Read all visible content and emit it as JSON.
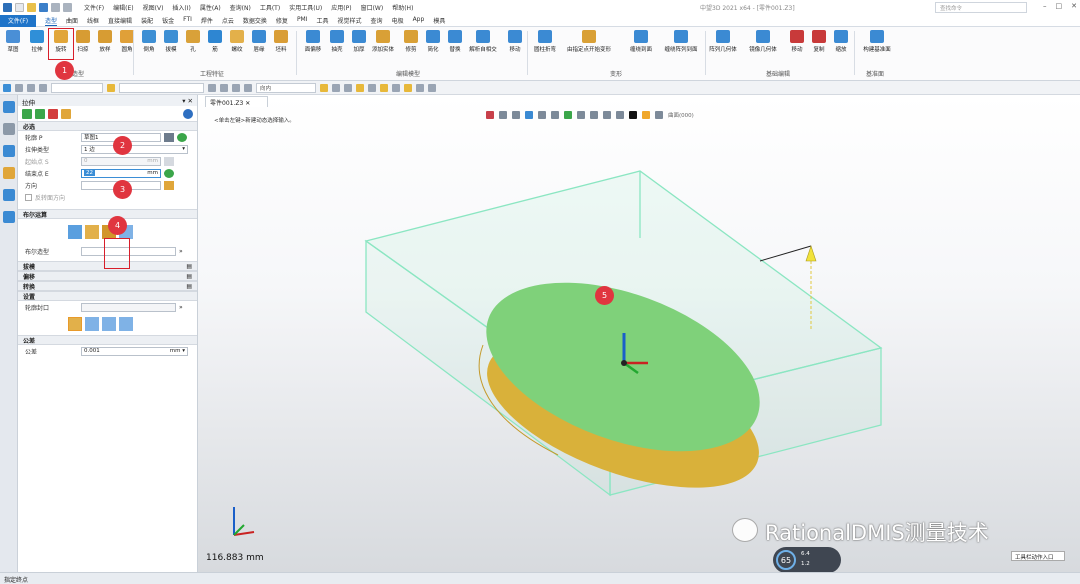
{
  "menu": [
    "文件(F)",
    "编辑(E)",
    "视图(V)",
    "插入(I)",
    "属性(A)",
    "查询(N)",
    "工具(T)",
    "实用工具(U)",
    "应用(P)",
    "窗口(W)",
    "帮助(H)"
  ],
  "app_title": "中望3D 2021 x64 - [零件001.Z3]",
  "search_placeholder": "查找命令",
  "file_tab": "文件(F)",
  "ribbon_tabs": [
    "造型",
    "曲面",
    "线框",
    "直接编辑",
    "装配",
    "钣金",
    "FTI",
    "焊件",
    "点云",
    "数据交换",
    "修复",
    "PMI",
    "工具",
    "视觉样式",
    "查询",
    "电极",
    "App",
    "模具"
  ],
  "active_tab": "造型",
  "ribbon_buttons": [
    "草图",
    "拉伸",
    "旋转",
    "扫掠",
    "放样",
    "圆角",
    "倒角",
    "拔模",
    "孔",
    "筋",
    "螺纹",
    "唇缘",
    "坯料",
    "面偏移",
    "抽壳",
    "加厚",
    "添加实体",
    "修剪",
    "简化",
    "替换",
    "解析自相交",
    "移动",
    "圆柱折弯",
    "由指定点开始变形",
    "缠绕到面",
    "缠绕阵列到面",
    "阵列几何体",
    "镜像几何体",
    "移动",
    "复制",
    "缩放",
    "构建基准面"
  ],
  "ribbon_groups": [
    "基础造型",
    "工程特征",
    "编辑模型",
    "变形",
    "基础编辑",
    "基准面"
  ],
  "toolstrip": {
    "filter_value": "",
    "view_dir": "向内"
  },
  "panel": {
    "title": "拉伸",
    "required_section": "必选",
    "profile_label": "轮廓 P",
    "profile_value": "草图1",
    "extrude_type_label": "拉伸类型",
    "extrude_type_value": "1 边",
    "start_label": "起始点 S",
    "start_value": "0",
    "end_label": "结束点 E",
    "end_value": "22",
    "unit_mm": "mm",
    "direction_label": "方向",
    "reverse_label": "反转面方向",
    "boolean_section": "布尔运算",
    "boolean_shape_label": "布尔造型",
    "draft_section": "拔模",
    "offset_section": "偏移",
    "transform_section": "转换",
    "settings_section": "设置",
    "profile_cap_label": "轮廓封口",
    "tolerance_section": "公差",
    "tolerance_label": "公差",
    "tolerance_value": "0.001"
  },
  "viewport": {
    "tab_label": "零件001.Z3",
    "hint": "<单击左键>新建动态选择输入。",
    "scale_text": "116.883 mm",
    "watermark": "RationalDMIS测量技术",
    "perf_value": "65",
    "perf_up": "6.4",
    "perf_down": "1.2",
    "tip_box": "工具栏动作入口",
    "view_filter": "曲面(000)"
  },
  "badges": [
    "1",
    "2",
    "3",
    "4",
    "5"
  ],
  "status_text": "指定终点",
  "colors": {
    "accent": "#1f74c9",
    "extrude_face": "#7fd17a",
    "extrude_side": "#d9b13a",
    "bbox": "#8be6c2",
    "badge": "#e0353f"
  }
}
